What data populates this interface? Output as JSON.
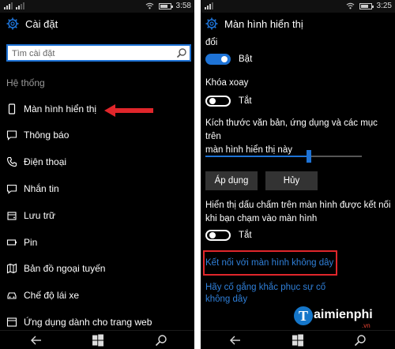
{
  "left": {
    "status": {
      "time": "3:58"
    },
    "header": {
      "title": "Cài đặt"
    },
    "search": {
      "placeholder": "Tìm cài đặt"
    },
    "section_label": "Hệ thống",
    "items": [
      {
        "label": "Màn hình hiển thị",
        "icon": "phone-icon"
      },
      {
        "label": "Thông báo",
        "icon": "notification-icon"
      },
      {
        "label": "Điện thoại",
        "icon": "phone-call-icon"
      },
      {
        "label": "Nhắn tin",
        "icon": "message-icon"
      },
      {
        "label": "Lưu trữ",
        "icon": "storage-icon"
      },
      {
        "label": "Pin",
        "icon": "battery-icon"
      },
      {
        "label": "Bản đồ ngoại tuyến",
        "icon": "map-icon"
      },
      {
        "label": "Chế độ lái xe",
        "icon": "car-icon"
      },
      {
        "label": "Ứng dụng dành cho trang web",
        "icon": "web-app-icon"
      }
    ]
  },
  "right": {
    "status": {
      "time": "3:25"
    },
    "header": {
      "title": "Màn hình hiển thị"
    },
    "partial_text": "đổi",
    "toggle1": {
      "label": "Bật",
      "state": "on"
    },
    "rotation_lock": {
      "title": "Khóa xoay",
      "label": "Tắt",
      "state": "off"
    },
    "text_size": {
      "line1": "Kích thước văn bản, ứng dụng và các mục trên",
      "line2": "màn hình hiển thị này",
      "level_percent": 66
    },
    "buttons": {
      "apply": "Áp dụng",
      "cancel": "Hủy"
    },
    "dots_setting": {
      "line1": "Hiển thị dấu chấm trên màn hình được kết nối",
      "line2": "khi bạn chạm vào màn hình",
      "label": "Tắt",
      "state": "off"
    },
    "link_wireless": "Kết nối với màn hình không dây",
    "link_troubleshoot": {
      "line1": "Hãy cố gắng khắc phục sự cố",
      "line2": "không dây"
    }
  },
  "watermark": {
    "letter": "T",
    "text": "aimienphi",
    "sub": ".vn"
  },
  "colors": {
    "accent": "#1e73d6",
    "highlight": "#e0262b",
    "link": "#2f7fd8"
  }
}
